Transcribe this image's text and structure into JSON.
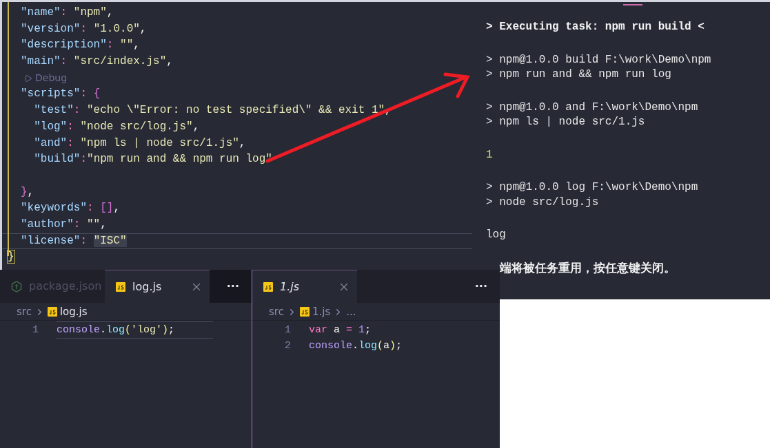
{
  "package_editor": {
    "lines": [
      {
        "kind": "code",
        "current": false,
        "tokens": [
          {
            "text": "\"name\"",
            "kind": "key"
          },
          {
            "text": ": ",
            "kind": "colon"
          },
          {
            "text": "\"npm\"",
            "kind": "string"
          },
          {
            "text": ",",
            "kind": "punct"
          }
        ]
      },
      {
        "kind": "code",
        "current": false,
        "tokens": [
          {
            "text": "\"version\"",
            "kind": "key"
          },
          {
            "text": ": ",
            "kind": "colon"
          },
          {
            "text": "\"1.0.0\"",
            "kind": "string"
          },
          {
            "text": ",",
            "kind": "punct"
          }
        ]
      },
      {
        "kind": "code",
        "current": false,
        "tokens": [
          {
            "text": "\"description\"",
            "kind": "key"
          },
          {
            "text": ": ",
            "kind": "colon"
          },
          {
            "text": "\"\"",
            "kind": "string"
          },
          {
            "text": ",",
            "kind": "punct"
          }
        ]
      },
      {
        "kind": "code",
        "current": false,
        "tokens": [
          {
            "text": "\"main\"",
            "kind": "key"
          },
          {
            "text": ": ",
            "kind": "colon"
          },
          {
            "text": "\"src/index.js\"",
            "kind": "string"
          },
          {
            "text": ",",
            "kind": "punct"
          }
        ]
      },
      {
        "kind": "codelens",
        "current": false,
        "label": "Debug"
      },
      {
        "kind": "code",
        "current": false,
        "tokens": [
          {
            "text": "\"scripts\"",
            "kind": "key"
          },
          {
            "text": ": ",
            "kind": "colon"
          },
          {
            "text": "{",
            "kind": "brace"
          }
        ]
      },
      {
        "kind": "code",
        "current": false,
        "tokens": [
          {
            "text": "  \"test\"",
            "kind": "key"
          },
          {
            "text": ": ",
            "kind": "colon"
          },
          {
            "text": "\"echo \\\"Error: no test specified\\\" && exit 1\"",
            "kind": "string"
          },
          {
            "text": ",",
            "kind": "punct"
          }
        ]
      },
      {
        "kind": "code",
        "current": false,
        "tokens": [
          {
            "text": "  \"log\"",
            "kind": "key"
          },
          {
            "text": ": ",
            "kind": "colon"
          },
          {
            "text": "\"node src/log.js\"",
            "kind": "string"
          },
          {
            "text": ",",
            "kind": "punct"
          }
        ]
      },
      {
        "kind": "code",
        "current": false,
        "tokens": [
          {
            "text": "  \"and\"",
            "kind": "key"
          },
          {
            "text": ": ",
            "kind": "colon"
          },
          {
            "text": "\"npm ls | node src/1.js\"",
            "kind": "string"
          },
          {
            "text": ",",
            "kind": "punct"
          }
        ]
      },
      {
        "kind": "code",
        "current": false,
        "tokens": [
          {
            "text": "  \"build\"",
            "kind": "key"
          },
          {
            "text": ":",
            "kind": "colon"
          },
          {
            "text": "\"npm run and && npm run log\"",
            "kind": "string"
          }
        ]
      },
      {
        "kind": "blank",
        "current": false
      },
      {
        "kind": "code",
        "current": false,
        "tokens": [
          {
            "text": "}",
            "kind": "brace"
          },
          {
            "text": ",",
            "kind": "punct"
          }
        ]
      },
      {
        "kind": "code",
        "current": false,
        "tokens": [
          {
            "text": "\"keywords\"",
            "kind": "key"
          },
          {
            "text": ": ",
            "kind": "colon"
          },
          {
            "text": "[]",
            "kind": "brace"
          },
          {
            "text": ",",
            "kind": "punct"
          }
        ]
      },
      {
        "kind": "code",
        "current": false,
        "tokens": [
          {
            "text": "\"author\"",
            "kind": "key"
          },
          {
            "text": ": ",
            "kind": "colon"
          },
          {
            "text": "\"\"",
            "kind": "string"
          },
          {
            "text": ",",
            "kind": "punct"
          }
        ]
      },
      {
        "kind": "code",
        "current": true,
        "tokens": [
          {
            "text": "\"license\"",
            "kind": "key"
          },
          {
            "text": ": ",
            "kind": "colon"
          },
          {
            "text": "\"ISC\"",
            "kind": "selection"
          }
        ]
      },
      {
        "kind": "outdent",
        "current": false,
        "tokens": [
          {
            "text": "}",
            "kind": "brace_match"
          }
        ]
      }
    ]
  },
  "terminal": {
    "blocks": [
      {
        "lines": [
          {
            "text": "> Executing task: npm run build <",
            "kind": "task"
          }
        ]
      },
      {
        "lines": [
          {
            "text": "> npm@1.0.0 build F:\\work\\Demo\\npm",
            "kind": "output"
          },
          {
            "text": "> npm run and && npm run log",
            "kind": "output"
          }
        ]
      },
      {
        "lines": [
          {
            "text": "> npm@1.0.0 and F:\\work\\Demo\\npm",
            "kind": "output"
          },
          {
            "text": "> npm ls | node src/1.js",
            "kind": "output"
          }
        ]
      },
      {
        "lines": [
          {
            "text": "1",
            "kind": "result"
          }
        ]
      },
      {
        "lines": [
          {
            "text": "> npm@1.0.0 log F:\\work\\Demo\\npm",
            "kind": "output"
          },
          {
            "text": "> node src/log.js",
            "kind": "output"
          }
        ]
      },
      {
        "lines": [
          {
            "text": "log",
            "kind": "output"
          }
        ]
      },
      {
        "lines": [
          {
            "text": "端将被任务重用，按任意键关闭。",
            "kind": "notice"
          }
        ]
      }
    ]
  },
  "editor_groups": [
    {
      "tabs": [
        {
          "label": "package.json",
          "kind": "node",
          "selected": false,
          "preview": false
        },
        {
          "label": "log.js",
          "kind": "js",
          "selected": true,
          "preview": false
        }
      ],
      "more": "···",
      "breadcrumbs": [
        {
          "label": "src",
          "kind": "folder"
        },
        {
          "label": "log.js",
          "kind": "js"
        }
      ],
      "lines": [
        {
          "number": "1",
          "current": true,
          "tokens": [
            {
              "text": "console",
              "kind": "object"
            },
            {
              "text": ".",
              "kind": "plain"
            },
            {
              "text": "log",
              "kind": "func"
            },
            {
              "text": "(",
              "kind": "paren"
            },
            {
              "text": "'log'",
              "kind": "string"
            },
            {
              "text": ")",
              "kind": "paren"
            },
            {
              "text": ";",
              "kind": "plain"
            }
          ]
        }
      ]
    },
    {
      "tabs": [
        {
          "label": "1.js",
          "kind": "js",
          "selected": true,
          "preview": true
        }
      ],
      "more": "···",
      "breadcrumbs": [
        {
          "label": "src",
          "kind": "folder"
        },
        {
          "label": "1.js",
          "kind": "js"
        },
        {
          "label": "...",
          "kind": "ellipsis"
        }
      ],
      "lines": [
        {
          "number": "1",
          "current": false,
          "tokens": [
            {
              "text": "var",
              "kind": "keyword"
            },
            {
              "text": " a ",
              "kind": "plain"
            },
            {
              "text": "= ",
              "kind": "keyword"
            },
            {
              "text": "1",
              "kind": "number"
            },
            {
              "text": ";",
              "kind": "plain"
            }
          ]
        },
        {
          "number": "2",
          "current": false,
          "tokens": [
            {
              "text": "console",
              "kind": "object"
            },
            {
              "text": ".",
              "kind": "plain"
            },
            {
              "text": "log",
              "kind": "func"
            },
            {
              "text": "(",
              "kind": "paren"
            },
            {
              "text": "a",
              "kind": "plain"
            },
            {
              "text": ")",
              "kind": "paren"
            },
            {
              "text": ";",
              "kind": "plain"
            }
          ]
        }
      ]
    }
  ]
}
